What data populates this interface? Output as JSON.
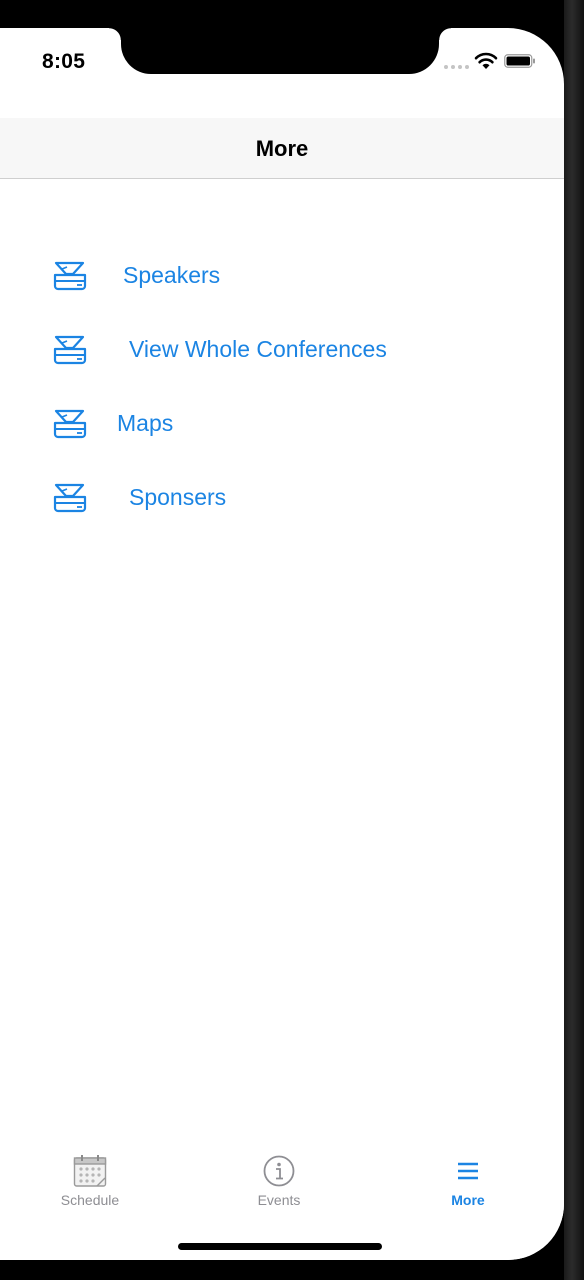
{
  "status_bar": {
    "time": "8:05",
    "wifi_icon": "wifi-icon",
    "battery_icon": "battery-icon"
  },
  "nav": {
    "title": "More"
  },
  "menu": {
    "items": [
      {
        "label": "Speakers",
        "icon": "scanner-icon"
      },
      {
        "label": "View Whole Conferences",
        "icon": "scanner-icon"
      },
      {
        "label": "Maps",
        "icon": "scanner-icon"
      },
      {
        "label": "Sponsers",
        "icon": "scanner-icon"
      }
    ]
  },
  "tab_bar": {
    "tabs": [
      {
        "label": "Schedule",
        "icon": "calendar-icon",
        "active": false
      },
      {
        "label": "Events",
        "icon": "info-icon",
        "active": false
      },
      {
        "label": "More",
        "icon": "menu-icon",
        "active": true
      }
    ]
  },
  "colors": {
    "accent": "#1b84e3",
    "inactive": "#8e8e93",
    "nav_background": "#f7f7f7"
  }
}
